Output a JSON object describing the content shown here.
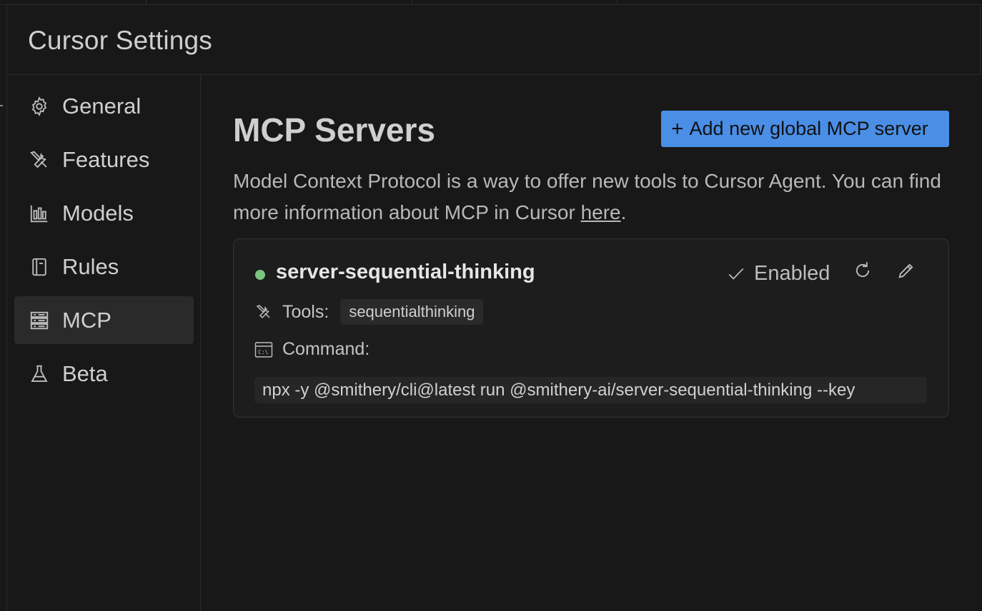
{
  "window": {
    "title": "Cursor Settings"
  },
  "sidebar": {
    "items": [
      {
        "label": "General",
        "icon": "gear-icon",
        "active": false
      },
      {
        "label": "Features",
        "icon": "tools-icon",
        "active": false
      },
      {
        "label": "Models",
        "icon": "chart-icon",
        "active": false
      },
      {
        "label": "Rules",
        "icon": "book-icon",
        "active": false
      },
      {
        "label": "MCP",
        "icon": "server-icon",
        "active": true
      },
      {
        "label": "Beta",
        "icon": "flask-icon",
        "active": false
      }
    ]
  },
  "main": {
    "title": "MCP Servers",
    "add_button": {
      "plus": "+",
      "label": "Add new global MCP server"
    },
    "description": "Model Context Protocol is a way to offer new tools to Cursor Agent. You can find more information about MCP in Cursor ",
    "description_link": "here",
    "description_end": "."
  },
  "server": {
    "name": "server-sequential-thinking",
    "status_color": "#7bc47f",
    "enabled_label": "Enabled",
    "tools_label": "Tools:",
    "tools": [
      "sequentialthinking"
    ],
    "command_label": "Command:",
    "command": "npx -y @smithery/cli@latest run @smithery-ai/server-sequential-thinking --key"
  },
  "colors": {
    "accent": "#4a8ee6",
    "background": "#181818"
  }
}
